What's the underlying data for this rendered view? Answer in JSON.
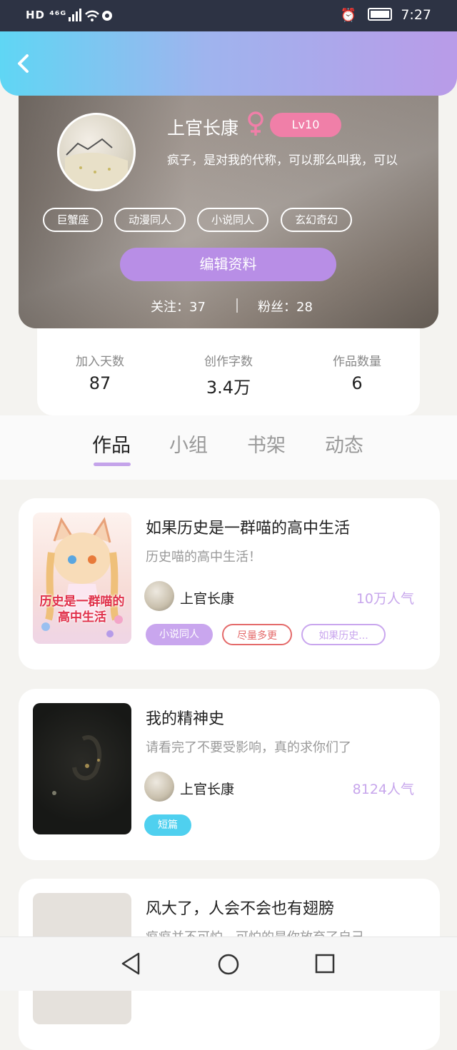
{
  "status_bar": {
    "left": "HD ⁴⁶ᴳ",
    "time": "7:27"
  },
  "profile": {
    "name": "上官长康",
    "level": "Lv10",
    "bio": "疯子，是对我的代称，可以那么叫我，可以",
    "tags": [
      "巨蟹座",
      "动漫同人",
      "小说同人",
      "玄幻奇幻"
    ],
    "edit_label": "编辑资料",
    "following": "关注：37",
    "fans": "粉丝：28"
  },
  "stats": [
    {
      "label": "加入天数",
      "value": "87"
    },
    {
      "label": "创作字数",
      "value": "3.4万"
    },
    {
      "label": "作品数量",
      "value": "6"
    }
  ],
  "tabs": [
    "作品",
    "小组",
    "书架",
    "动态"
  ],
  "works": [
    {
      "title": "如果历史是一群喵的高中生活",
      "desc": "历史喵的高中生活！",
      "author": "上官长康",
      "popularity": "10万人气",
      "cover_text": "历史是一群喵的高中生活",
      "tags": [
        "小说同人",
        "尽量多更",
        "如果历史..."
      ]
    },
    {
      "title": "我的精神史",
      "desc": "请看完了不要受影响，真的求你们了",
      "author": "上官长康",
      "popularity": "8124人气",
      "tags": [
        "短篇"
      ]
    },
    {
      "title": "风大了，人会不会也有翅膀",
      "desc": "疯疯并不可怕，可怕的是你放弃了自己"
    }
  ],
  "colors": {
    "accent": "#b88ee6",
    "pink": "#f07fa8",
    "cyan": "#4fd0ef",
    "red_tag": "#e46a6a"
  }
}
